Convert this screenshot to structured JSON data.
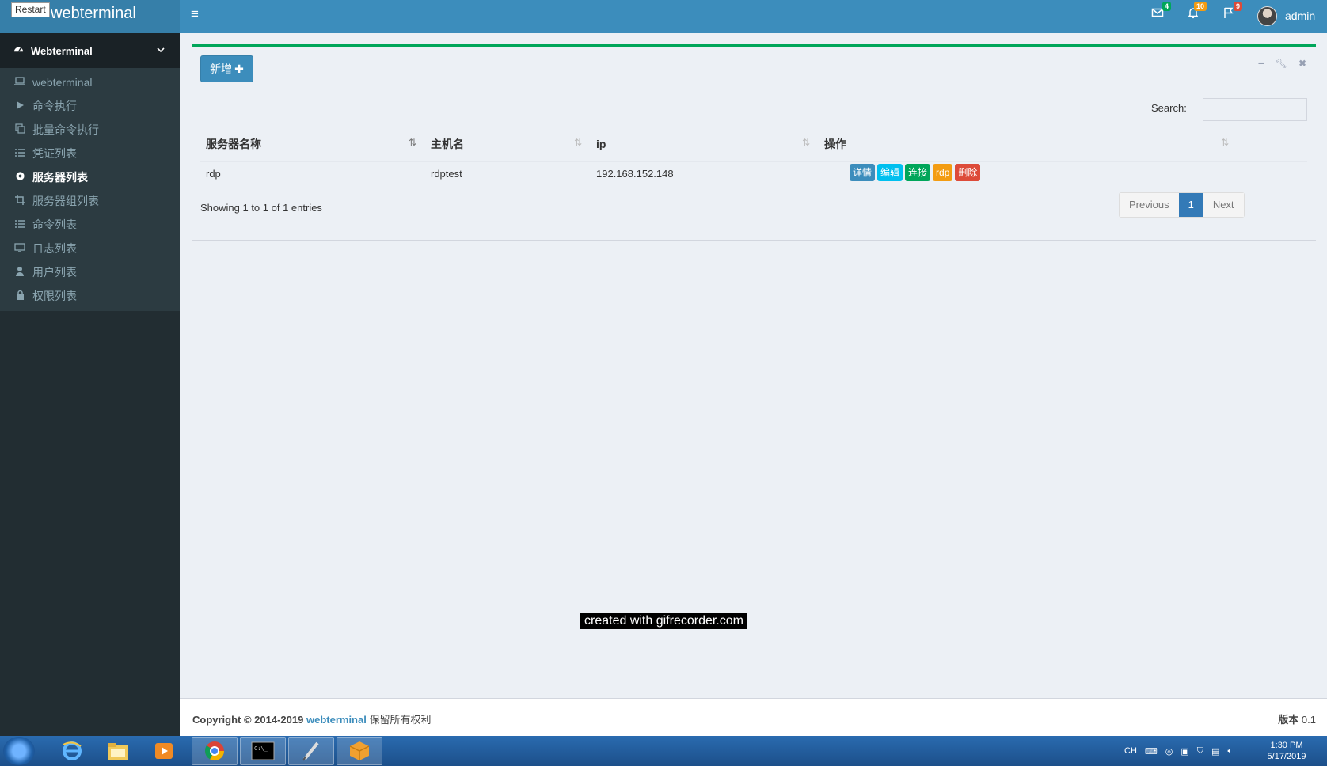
{
  "header": {
    "logo": "webterminal",
    "restart_label": "Restart",
    "menu_toggle": "≡",
    "mail_badge": "4",
    "bell_badge": "10",
    "flag_badge": "9",
    "user": "admin",
    "colors": {
      "bar": "#3c8dbc",
      "logo_bg": "#367fa9"
    }
  },
  "sidebar": {
    "section": "Webterminal",
    "items": [
      {
        "label": "webterminal",
        "icon": "laptop-icon"
      },
      {
        "label": "命令执行",
        "icon": "play-icon"
      },
      {
        "label": "批量命令执行",
        "icon": "copy-icon"
      },
      {
        "label": "凭证列表",
        "icon": "list-icon"
      },
      {
        "label": "服务器列表",
        "icon": "gear-icon"
      },
      {
        "label": "服务器组列表",
        "icon": "crop-icon"
      },
      {
        "label": "命令列表",
        "icon": "list-icon"
      },
      {
        "label": "日志列表",
        "icon": "monitor-icon"
      },
      {
        "label": "用户列表",
        "icon": "user-icon"
      },
      {
        "label": "权限列表",
        "icon": "lock-icon"
      }
    ]
  },
  "main": {
    "add_button": "新增",
    "search_label": "Search:",
    "search_value": "",
    "columns": [
      "服务器名称",
      "主机名",
      "ip",
      "操作"
    ],
    "rows": [
      {
        "name": "rdp",
        "hostname": "rdptest",
        "ip": "192.168.152.148"
      }
    ],
    "actions": [
      {
        "label": "详情",
        "color": "#3c8dbc"
      },
      {
        "label": "编辑",
        "color": "#00c0ef"
      },
      {
        "label": "连接",
        "color": "#00a65a"
      },
      {
        "label": "rdp",
        "color": "#f39c12"
      },
      {
        "label": "删除",
        "color": "#dd4b39"
      }
    ],
    "showing": "Showing 1 to 1 of 1 entries",
    "pagination": {
      "previous": "Previous",
      "current": "1",
      "next": "Next"
    }
  },
  "watermark": "created with gifrecorder.com",
  "footer": {
    "copyright_prefix": "Copyright © 2014-2019",
    "brand": "webterminal",
    "rights": "保留所有权利",
    "version_label": "版本",
    "version_value": "0.1"
  },
  "taskbar": {
    "apps": [
      "ie-icon",
      "explorer-icon",
      "media-player-icon",
      "chrome-icon",
      "cmd-icon",
      "pen-icon",
      "virtualbox-icon"
    ],
    "tray_lang": "CH",
    "time": "1:30 PM",
    "date": "5/17/2019"
  }
}
